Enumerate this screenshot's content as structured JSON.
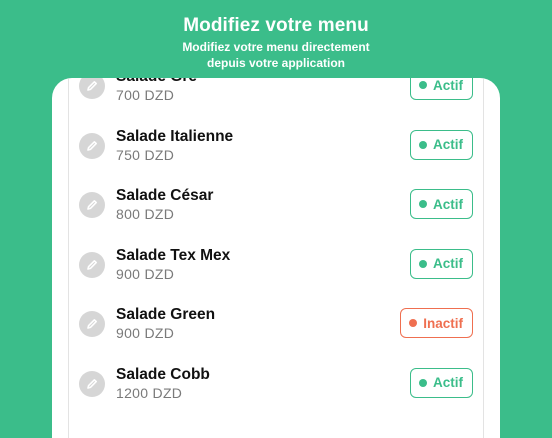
{
  "header": {
    "title": "Modifiez votre menu",
    "subtitle_line1": "Modifiez votre menu directement",
    "subtitle_line2": "depuis votre application"
  },
  "menu": {
    "items": [
      {
        "name": "Salade Gre",
        "price": "700 DZD",
        "status": "Actif",
        "active": true
      },
      {
        "name": "Salade Italienne",
        "price": "750 DZD",
        "status": "Actif",
        "active": true
      },
      {
        "name": "Salade César",
        "price": "800 DZD",
        "status": "Actif",
        "active": true
      },
      {
        "name": "Salade Tex Mex",
        "price": "900 DZD",
        "status": "Actif",
        "active": true
      },
      {
        "name": "Salade Green",
        "price": "900 DZD",
        "status": "Inactif",
        "active": false
      },
      {
        "name": "Salade Cobb",
        "price": "1200 DZD",
        "status": "Actif",
        "active": true
      }
    ]
  },
  "colors": {
    "background": "#3bbd8a",
    "active": "#3bbd8a",
    "inactive": "#ef6f50",
    "edit_button": "#d6d6d6"
  },
  "icons": {
    "edit": "pencil-icon",
    "status": "dot-icon"
  }
}
